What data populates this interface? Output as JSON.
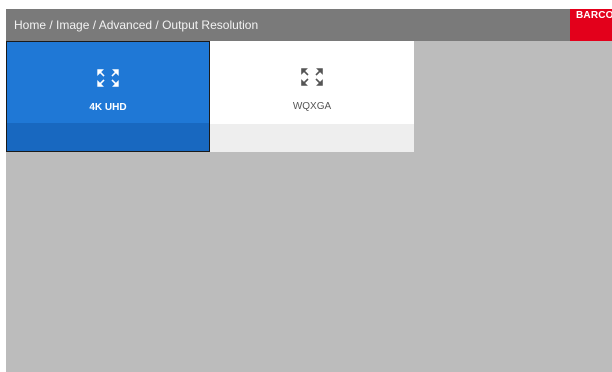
{
  "header": {
    "breadcrumb": "Home / Image / Advanced / Output Resolution",
    "logo_text": "BARCO"
  },
  "resolutions": [
    {
      "label": "4K UHD",
      "icon": "expand-arrows-icon",
      "selected": true
    },
    {
      "label": "WQXGA",
      "icon": "expand-arrows-icon",
      "selected": false
    }
  ],
  "colors": {
    "selected_tile": "#1f78d6",
    "header_bg": "#7a7a7a",
    "content_bg": "#bcbcbc",
    "brand_red": "#e3001b"
  }
}
